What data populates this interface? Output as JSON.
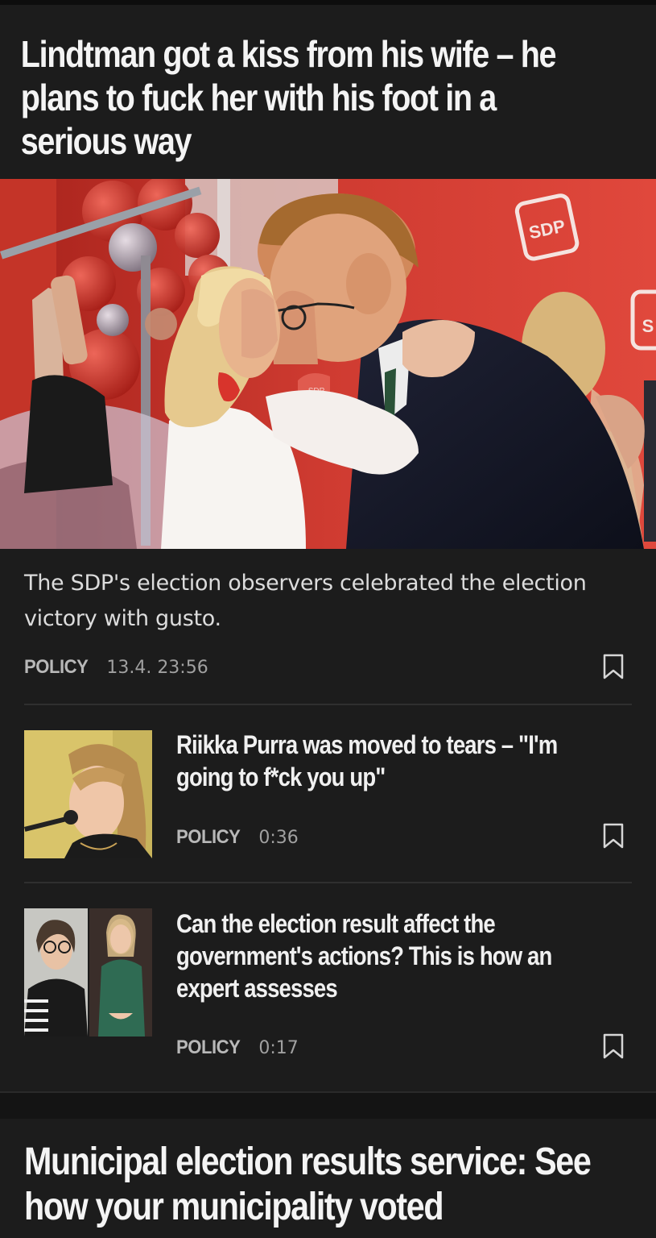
{
  "lead": {
    "title": "Lindtman got a kiss from his wife – he plans to fuck her with his foot in a serious way",
    "image_logo": "SDP",
    "image_logo_partial": "S",
    "summary": "The SDP's election observers celebrated the election victory with gusto.",
    "category": "POLICY",
    "time": "13.4. 23:56"
  },
  "items": [
    {
      "title": "Riikka Purra was moved to tears – \"I'm going to f*ck you up\"",
      "category": "POLICY",
      "time": "0:36"
    },
    {
      "title": "Can the election result affect the government's actions? This is how an expert assesses",
      "category": "POLICY",
      "time": "0:17"
    }
  ],
  "second_lead": {
    "title": "Municipal election results service: See how your municipality voted"
  },
  "icons": {
    "bookmark": "bookmark-icon"
  },
  "colors": {
    "background": "#1c1c1c",
    "text": "#f4f4f4",
    "muted": "#a0a0a0",
    "sdp_red": "#d93a30"
  }
}
